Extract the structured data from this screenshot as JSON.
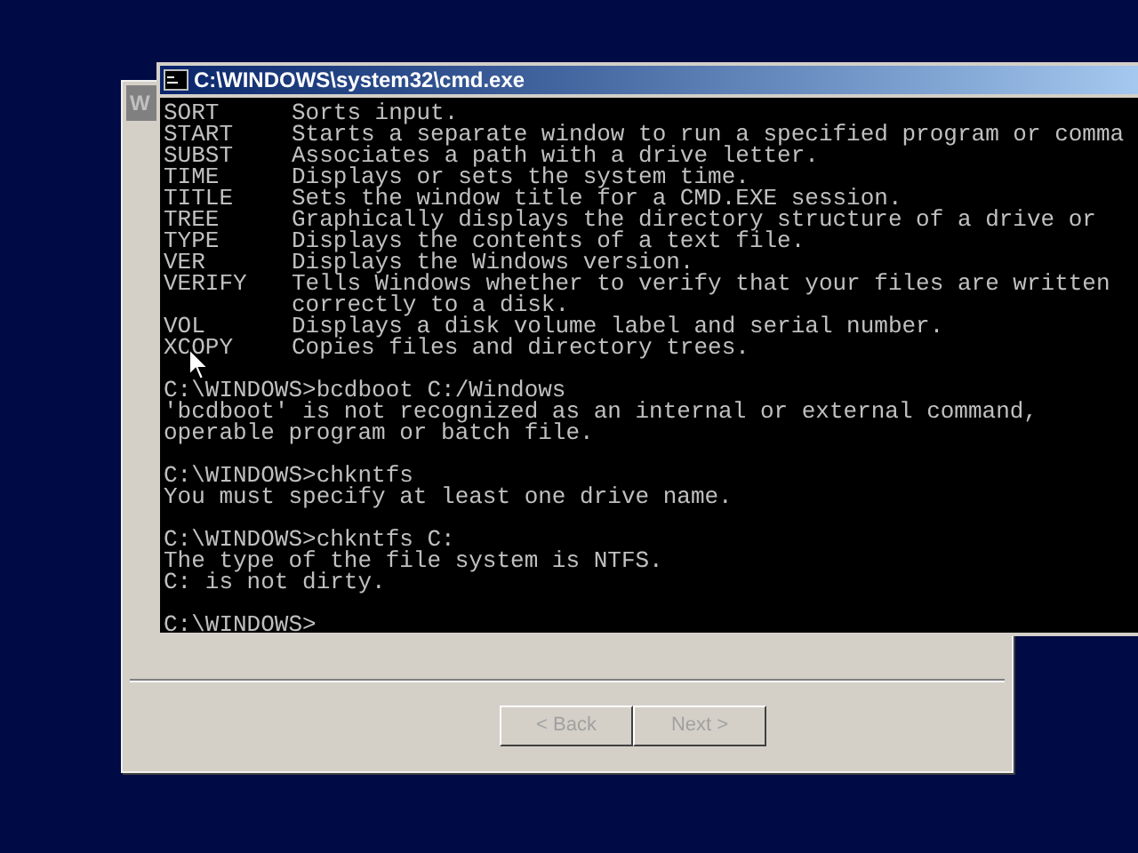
{
  "background_window": {
    "title": "W",
    "buttons": [
      {
        "label": "< Back",
        "disabled": true
      },
      {
        "label": "Next >",
        "disabled": true
      }
    ]
  },
  "console_window": {
    "title": "C:\\WINDOWS\\system32\\cmd.exe",
    "lines": [
      {
        "kind": "help",
        "command": "SORT",
        "description": "Sorts input."
      },
      {
        "kind": "help",
        "command": "START",
        "description": "Starts a separate window to run a specified program or comma"
      },
      {
        "kind": "help",
        "command": "SUBST",
        "description": "Associates a path with a drive letter."
      },
      {
        "kind": "help",
        "command": "TIME",
        "description": "Displays or sets the system time."
      },
      {
        "kind": "help",
        "command": "TITLE",
        "description": "Sets the window title for a CMD.EXE session."
      },
      {
        "kind": "help",
        "command": "TREE",
        "description": "Graphically displays the directory structure of a drive or"
      },
      {
        "kind": "help",
        "command": "TYPE",
        "description": "Displays the contents of a text file."
      },
      {
        "kind": "help",
        "command": "VER",
        "description": "Displays the Windows version."
      },
      {
        "kind": "help",
        "command": "VERIFY",
        "description": "Tells Windows whether to verify that your files are written"
      },
      {
        "kind": "continuation",
        "text": "correctly to a disk."
      },
      {
        "kind": "help",
        "command": "VOL",
        "description": "Displays a disk volume label and serial number."
      },
      {
        "kind": "help",
        "command": "XCOPY",
        "description": "Copies files and directory trees."
      },
      {
        "kind": "blank"
      },
      {
        "kind": "text",
        "text": "C:\\WINDOWS>bcdboot C:/Windows"
      },
      {
        "kind": "text",
        "text": "'bcdboot' is not recognized as an internal or external command,"
      },
      {
        "kind": "text",
        "text": "operable program or batch file."
      },
      {
        "kind": "blank"
      },
      {
        "kind": "text",
        "text": "C:\\WINDOWS>chkntfs"
      },
      {
        "kind": "text",
        "text": "You must specify at least one drive name."
      },
      {
        "kind": "blank"
      },
      {
        "kind": "text",
        "text": "C:\\WINDOWS>chkntfs C:"
      },
      {
        "kind": "text",
        "text": "The type of the file system is NTFS."
      },
      {
        "kind": "text",
        "text": "C: is not dirty."
      },
      {
        "kind": "blank"
      },
      {
        "kind": "text",
        "text": "C:\\WINDOWS>"
      }
    ]
  }
}
